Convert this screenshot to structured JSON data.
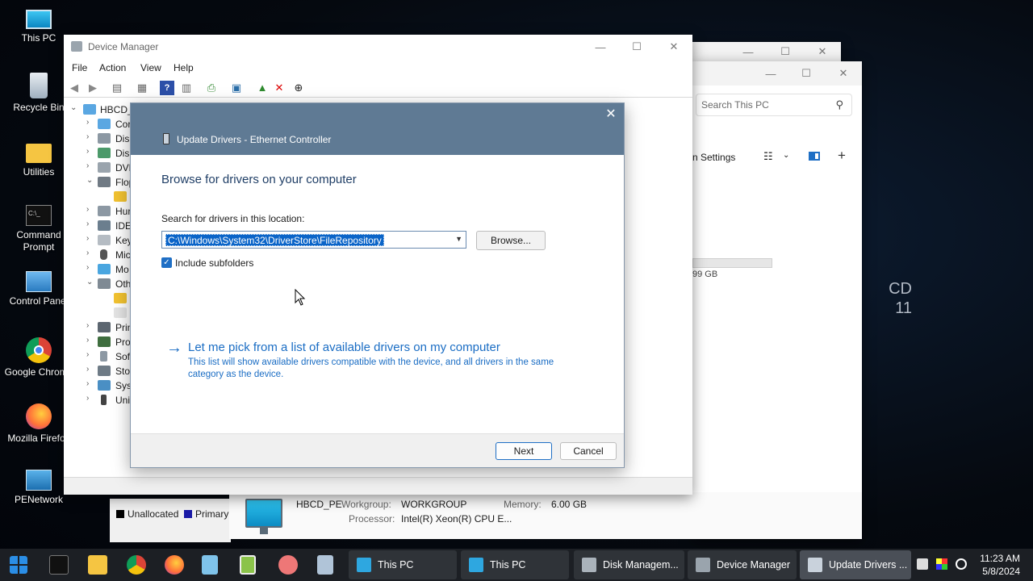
{
  "desktop": {
    "icons": [
      {
        "label": "This PC"
      },
      {
        "label": "Recycle Bin"
      },
      {
        "label": "Utilities"
      },
      {
        "label": "Command Prompt"
      },
      {
        "label": "Control Panel"
      },
      {
        "label": "Google Chrome"
      },
      {
        "label": "Mozilla Firefox"
      },
      {
        "label": "PENetwork"
      }
    ],
    "brand_line1": "CD",
    "brand_line2": "11"
  },
  "explorer": {
    "search_placeholder": "Search This PC",
    "settings_label": "n Settings",
    "disk_free": "99 GB",
    "details": {
      "name": "HBCD_PE",
      "workgroup_key": "Workgroup:",
      "workgroup_val": "WORKGROUP",
      "memory_key": "Memory:",
      "memory_val": "6.00 GB",
      "processor_key": "Processor:",
      "processor_val": "Intel(R) Xeon(R) CPU E..."
    }
  },
  "diskmgmt": {
    "legend_unallocated": "Unallocated",
    "legend_primary": "Primary"
  },
  "device_manager": {
    "title": "Device Manager",
    "menu": [
      "File",
      "Action",
      "View",
      "Help"
    ],
    "root": "HBCD_",
    "tree": [
      "Cor",
      "Disl",
      "Disp",
      "DVD",
      "Flop",
      "",
      "Hur",
      "IDE",
      "Key",
      "Mic",
      "Mo",
      "Oth",
      "",
      "",
      "Prin",
      "Pro",
      "Soft",
      "Stor",
      "Syst",
      "Uni"
    ]
  },
  "dialog": {
    "title": "Update Drivers - Ethernet Controller",
    "heading": "Browse for drivers on your computer",
    "location_label": "Search for drivers in this location:",
    "path_value": "C:\\Windows\\System32\\DriverStore\\FileRepository",
    "browse_label": "Browse...",
    "include_subfolders_label": "Include subfolders",
    "include_subfolders_checked": true,
    "pick_link": "Let me pick from a list of available drivers on my computer",
    "pick_desc": "This list will show available drivers compatible with the device, and all drivers in the same category as the device.",
    "next_label": "Next",
    "cancel_label": "Cancel"
  },
  "taskbar": {
    "tasks": [
      {
        "label": "This PC"
      },
      {
        "label": "This PC"
      },
      {
        "label": "Disk Managem..."
      },
      {
        "label": "Device Manager"
      },
      {
        "label": "Update Drivers ..."
      }
    ],
    "time": "11:23 AM",
    "date": "5/8/2024"
  }
}
